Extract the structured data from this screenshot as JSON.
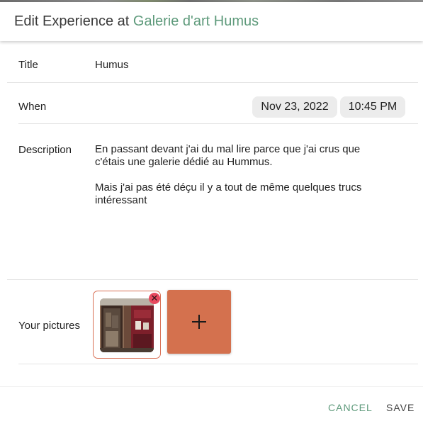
{
  "header": {
    "prefix": "Edit Experience at",
    "place": "Galerie d'art Humus"
  },
  "fields": {
    "title": {
      "label": "Title",
      "value": "Humus"
    },
    "when": {
      "label": "When",
      "date": "Nov 23, 2022",
      "time": "10:45 PM"
    },
    "description": {
      "label": "Description",
      "paragraphs": [
        "En passant devant j'ai du mal lire parce que j'ai crus que c'étais une galerie dédié au Hummus.",
        "Mais j'ai pas été déçu il y a tout de même quelques trucs intéressant"
      ]
    },
    "pictures": {
      "label": "Your pictures",
      "remove_icon": "close-icon",
      "add_icon": "plus-icon"
    }
  },
  "actions": {
    "cancel_label": "CANCEL",
    "save_label": "SAVE"
  },
  "colors": {
    "accent_green": "#5e9a7b",
    "add_button": "#d4714e",
    "remove_badge": "#e84a5f"
  }
}
